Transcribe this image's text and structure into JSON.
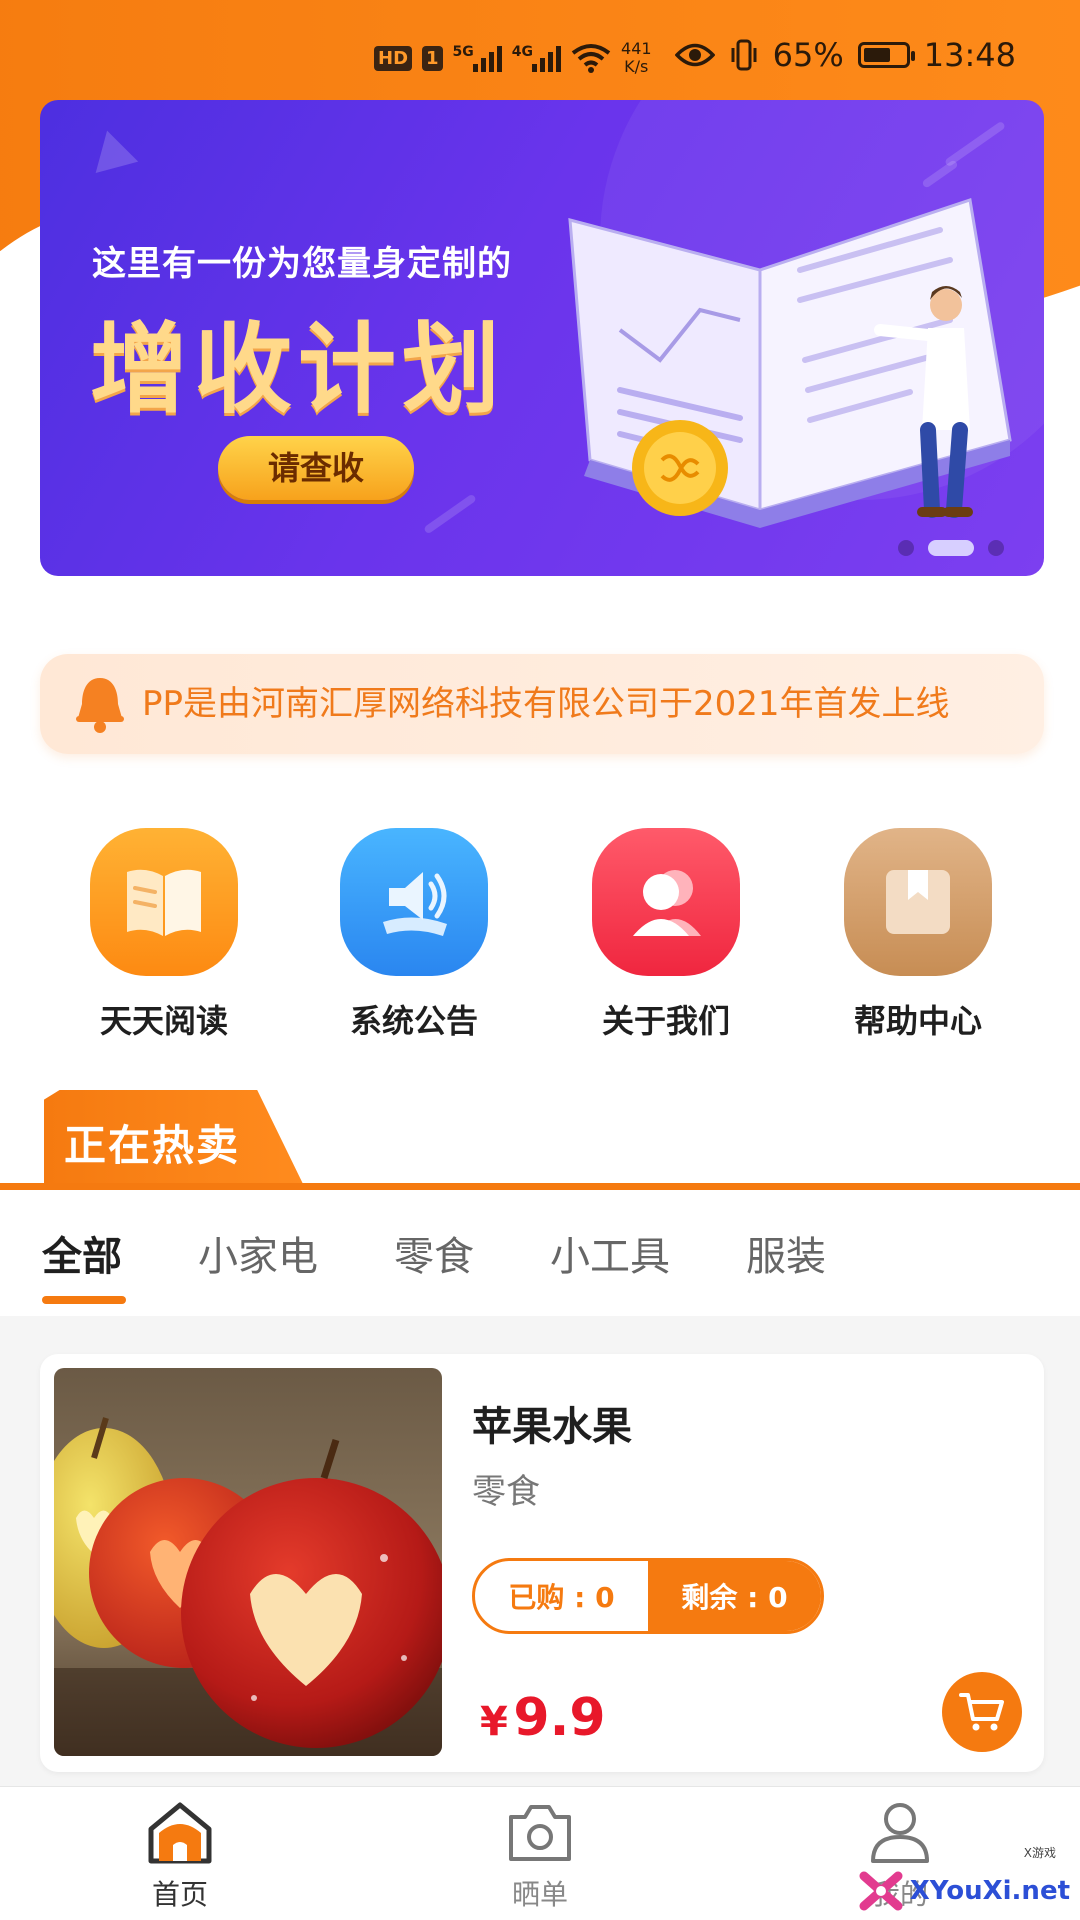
{
  "status_bar": {
    "hd": "HD",
    "sim": "1",
    "net1": "5G",
    "net2": "4G",
    "speed_value": "441",
    "speed_unit": "K/s",
    "battery_pct": "65%",
    "battery_level": 0.65,
    "time": "13:48"
  },
  "banner": {
    "subtitle": "这里有一份为您量身定制的",
    "headline": "增收计划",
    "cta": "请查收",
    "slide_count": 3,
    "active_slide": 2
  },
  "notice": {
    "text": "PP是由河南汇厚网络科技有限公司于2021年首发上线"
  },
  "quick_menu": [
    {
      "label": "天天阅读",
      "icon": "book-icon"
    },
    {
      "label": "系统公告",
      "icon": "speaker-icon"
    },
    {
      "label": "关于我们",
      "icon": "people-icon"
    },
    {
      "label": "帮助中心",
      "icon": "bookmark-box-icon"
    }
  ],
  "section": {
    "title": "正在热卖"
  },
  "tabs": [
    "全部",
    "小家电",
    "零食",
    "小工具",
    "服装"
  ],
  "active_tab": 0,
  "product": {
    "name": "苹果水果",
    "category": "零食",
    "bought": "已购 : 0",
    "remaining": "剩余 : 0",
    "currency": "¥",
    "price": "9.9"
  },
  "bottom_nav": [
    {
      "label": "首页",
      "icon": "home-icon"
    },
    {
      "label": "晒单",
      "icon": "camera-icon"
    },
    {
      "label": "我的",
      "icon": "user-icon"
    }
  ],
  "active_nav": 0,
  "watermark": {
    "text": "XYouXi.net",
    "small": "X游戏"
  },
  "colors": {
    "accent": "#f57a10",
    "price": "#e8182a",
    "banner": "#5a31e6"
  }
}
